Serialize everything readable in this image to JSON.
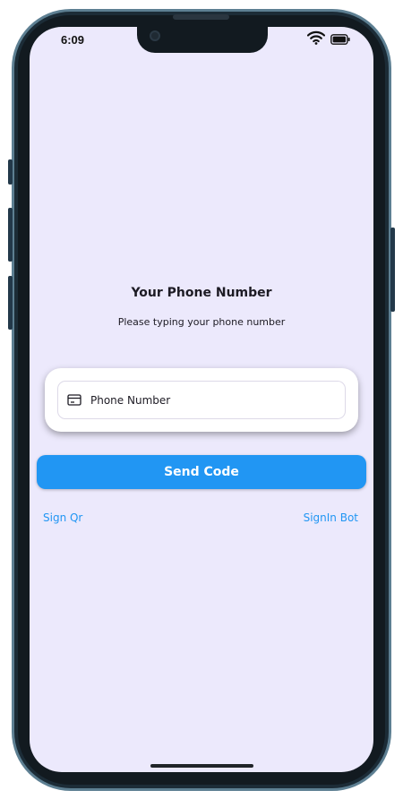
{
  "status_bar": {
    "time": "6:09",
    "icons": [
      "wifi-icon",
      "battery-icon"
    ]
  },
  "main": {
    "title": "Your Phone Number",
    "subtitle": "Please typing your phone number",
    "phone_input": {
      "placeholder": "Phone Number",
      "value": "",
      "icon": "card-icon"
    },
    "send_button_label": "Send Code",
    "sign_qr_label": "Sign Qr",
    "signin_bot_label": "SignIn Bot"
  },
  "colors": {
    "accent": "#2196f3",
    "screen_background": "#ece9fc",
    "text": "#1d1b24"
  }
}
